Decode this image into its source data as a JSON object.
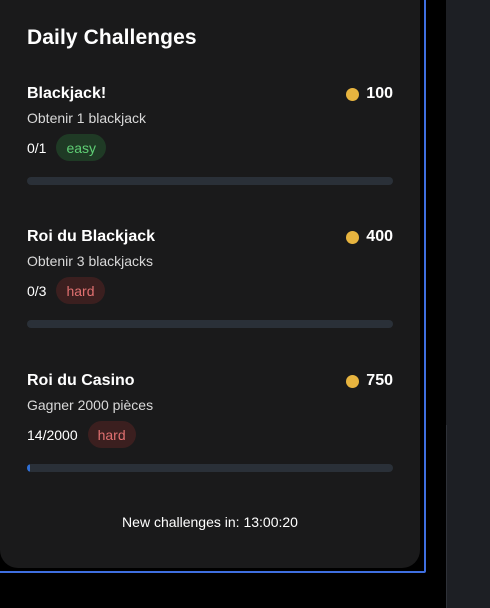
{
  "card": {
    "title": "Daily Challenges",
    "footer_label": "New challenges in: 13:00:20"
  },
  "colors": {
    "coin": "#e7b43f",
    "progress_fill": "#2f6fd6",
    "easy_bg": "#1f3a25",
    "easy_text": "#5fcf75",
    "hard_bg": "#3b1f1f",
    "hard_text": "#e07070"
  },
  "challenges": [
    {
      "name": "Blackjack!",
      "description": "Obtenir 1 blackjack",
      "reward": "100",
      "progress_text": "0/1",
      "progress_fraction": 0,
      "difficulty": "easy",
      "coin_icon": "coin-icon"
    },
    {
      "name": "Roi du Blackjack",
      "description": "Obtenir 3 blackjacks",
      "reward": "400",
      "progress_text": "0/3",
      "progress_fraction": 0,
      "difficulty": "hard",
      "coin_icon": "coin-icon"
    },
    {
      "name": "Roi du Casino",
      "description": "Gagner 2000 pièces",
      "reward": "750",
      "progress_text": "14/2000",
      "progress_fraction": 0.007,
      "difficulty": "hard",
      "coin_icon": "coin-icon"
    }
  ]
}
